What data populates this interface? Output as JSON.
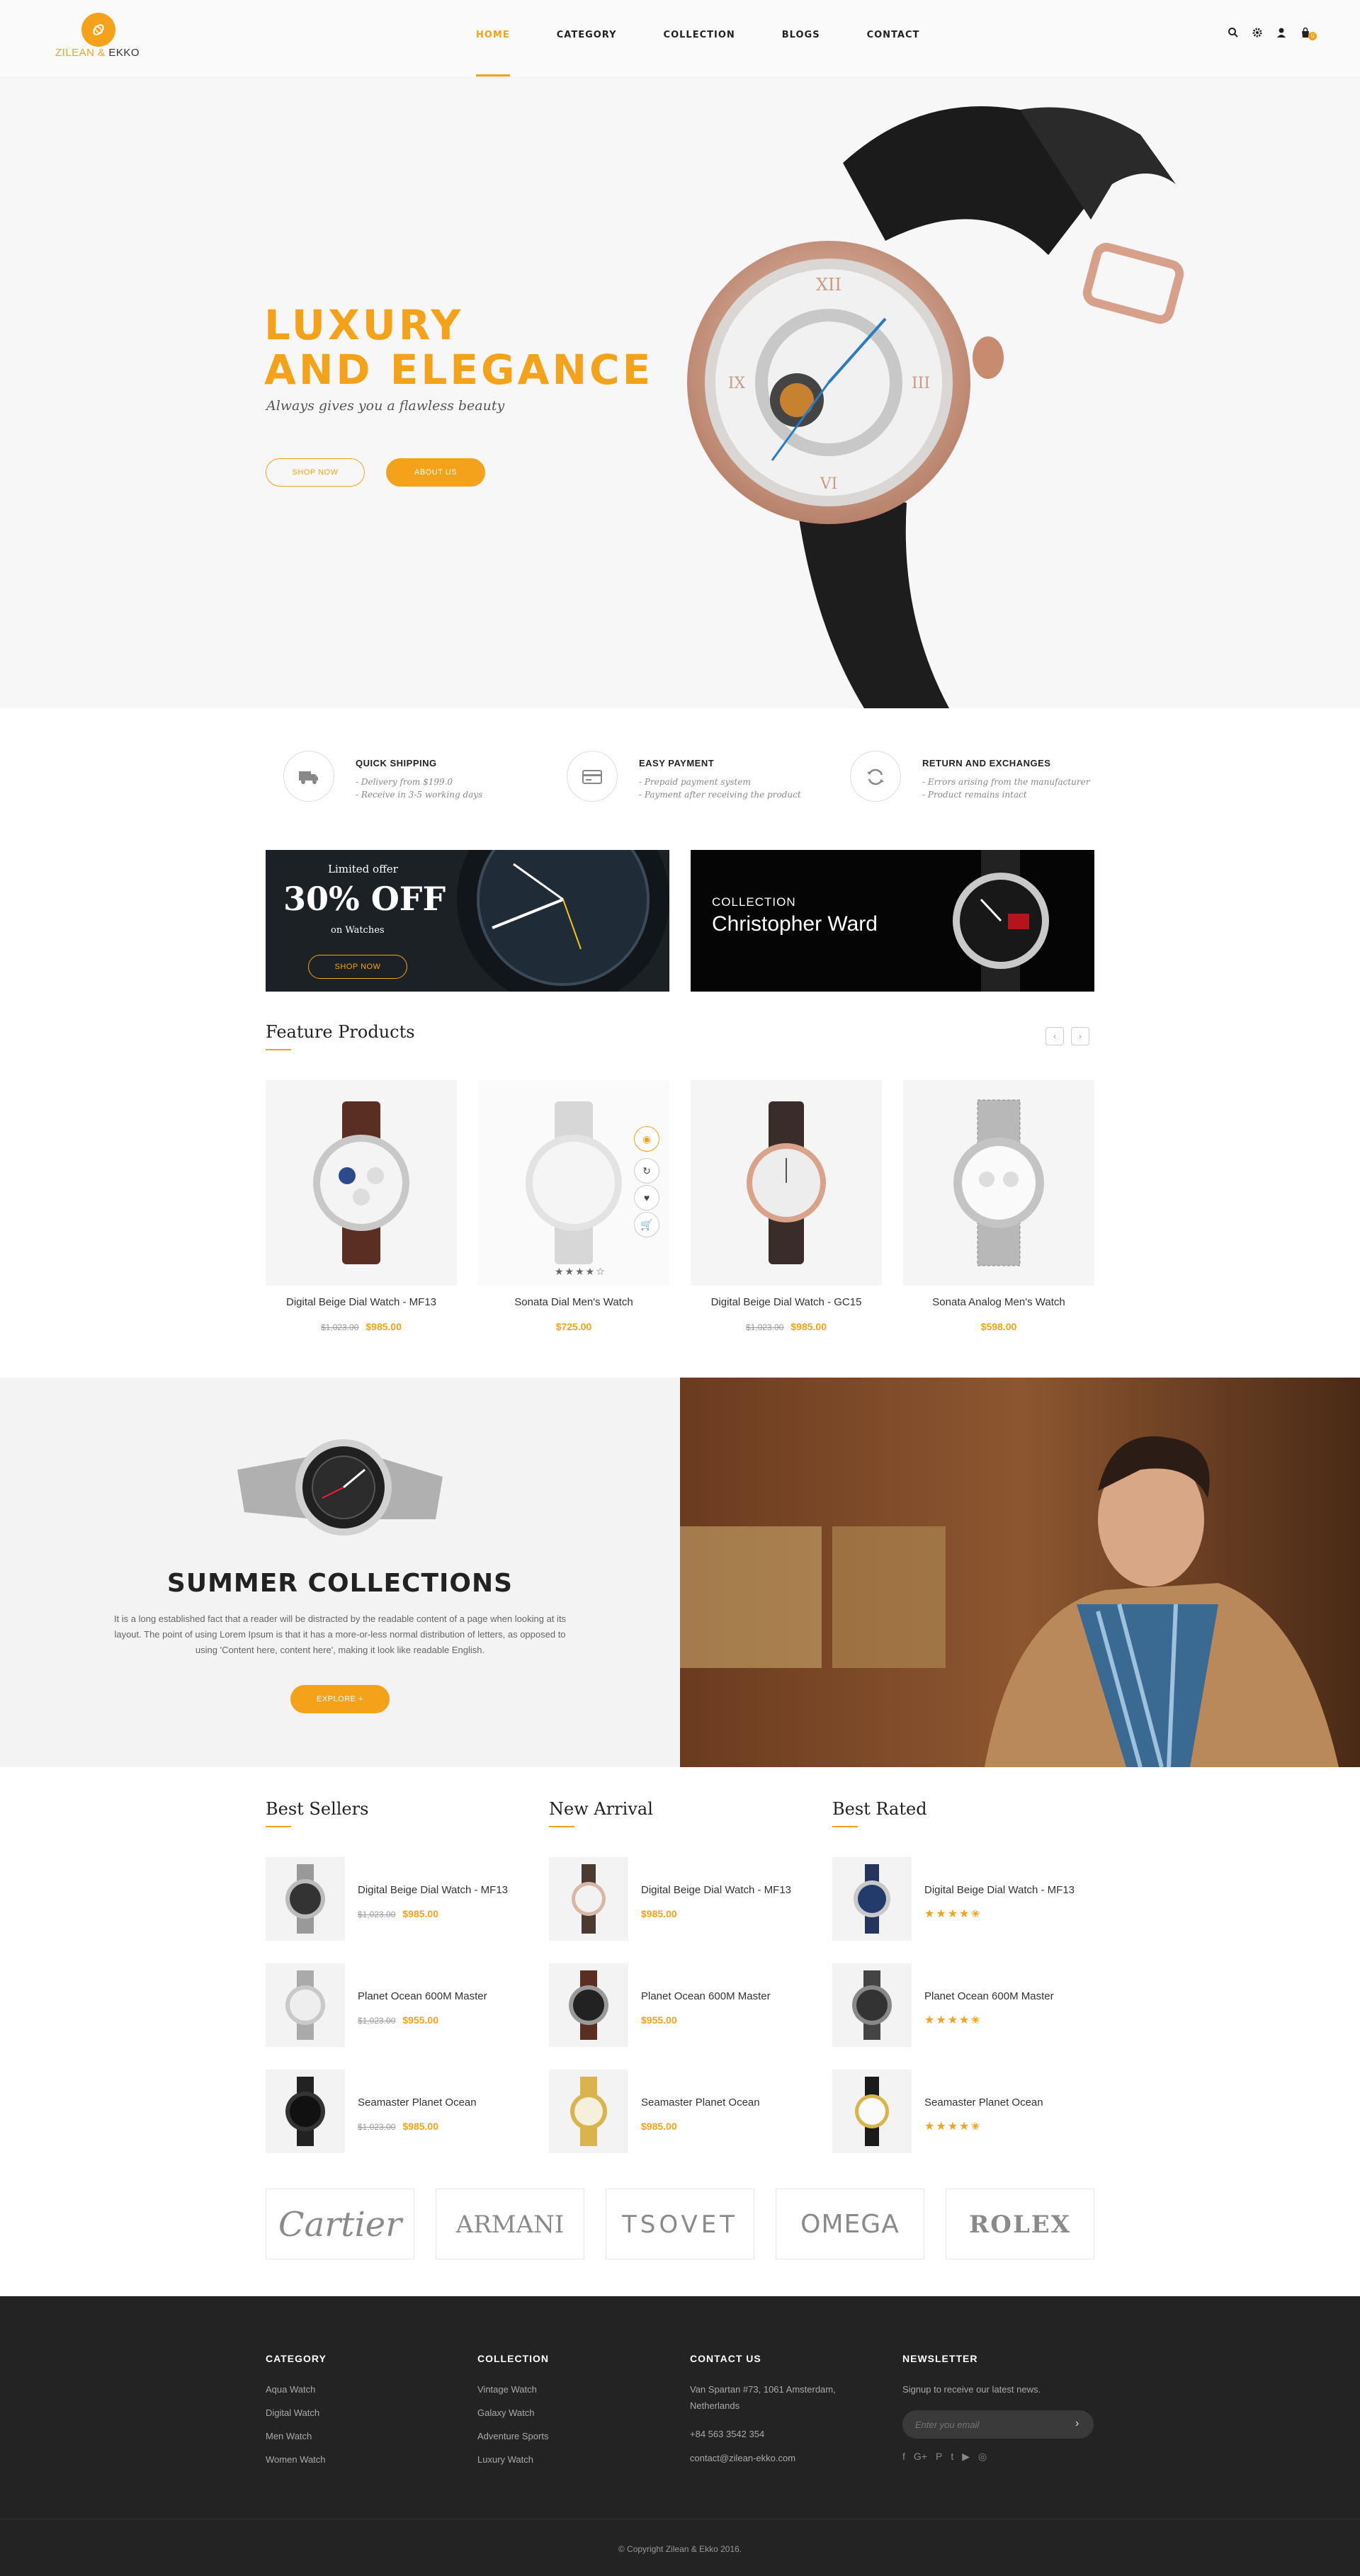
{
  "brand": {
    "name_part1": "ZILEAN & ",
    "name_part2": "EKKO",
    "accent": "#f5a21b"
  },
  "nav": {
    "items": [
      {
        "label": "HOME",
        "active": true
      },
      {
        "label": "CATEGORY"
      },
      {
        "label": "COLLECTION"
      },
      {
        "label": "BLOGS"
      },
      {
        "label": "CONTACT"
      }
    ]
  },
  "header_icons": [
    "search-icon",
    "gear-icon",
    "user-icon",
    "cart-icon"
  ],
  "cart_count": "0",
  "hero": {
    "title_line1": "LUXURY",
    "title_line2": "AND ELEGANCE",
    "subtitle": "Always gives you a flawless beauty",
    "btn_shop": "SHOP NOW",
    "btn_about": "ABOUT US"
  },
  "features": [
    {
      "icon": "truck-icon",
      "title": "QUICK SHIPPING",
      "line1": "- Delivery from $199.0",
      "line2": "- Receive in 3-5 working days"
    },
    {
      "icon": "credit-card-icon",
      "title": "EASY PAYMENT",
      "line1": "- Prepaid payment system",
      "line2": "- Payment after receiving the product"
    },
    {
      "icon": "refresh-icon",
      "title": "RETURN AND EXCHANGES",
      "line1": "- Errors arising from the manufacturer",
      "line2": "- Product remains intact"
    }
  ],
  "banner1": {
    "small": "Limited offer",
    "big": "30% OFF",
    "sub": "on Watches",
    "btn": "SHOP NOW"
  },
  "banner2": {
    "small": "COLLECTION",
    "big": "Christopher Ward"
  },
  "featured": {
    "title": "Feature Products",
    "products": [
      {
        "name": "Digital Beige Dial Watch - MF13",
        "old_price": "$1,023.00",
        "price": "$985.00"
      },
      {
        "name": "Sonata Dial Men's Watch",
        "old_price": "",
        "price": "$725.00"
      },
      {
        "name": "Digital Beige Dial Watch - GC15",
        "old_price": "$1,023.00",
        "price": "$985.00"
      },
      {
        "name": "Sonata Analog Men's Watch",
        "old_price": "",
        "price": "$598.00"
      }
    ]
  },
  "summer": {
    "title": "SUMMER COLLECTIONS",
    "text": "It is a long established fact that a reader will be distracted by the readable content of a page when looking at its layout. The point of using Lorem Ipsum is that it has a more-or-less normal distribution of letters, as opposed to using 'Content here, content here', making it look like readable English.",
    "btn": "EXPLORE +"
  },
  "best_sellers": {
    "title": "Best Sellers",
    "items": [
      {
        "name": "Digital Beige Dial Watch - MF13",
        "old_price": "$1,023.00",
        "price": "$985.00"
      },
      {
        "name": "Planet Ocean 600M Master",
        "old_price": "$1,023.00",
        "price": "$955.00"
      },
      {
        "name": "Seamaster Planet Ocean",
        "old_price": "$1,023.00",
        "price": "$985.00"
      }
    ]
  },
  "new_arrival": {
    "title": "New Arrival",
    "items": [
      {
        "name": "Digital Beige Dial Watch - MF13",
        "price": "$985.00"
      },
      {
        "name": "Planet Ocean 600M Master",
        "price": "$955.00"
      },
      {
        "name": "Seamaster Planet Ocean",
        "price": "$985.00"
      }
    ]
  },
  "best_rated": {
    "title": "Best Rated",
    "items": [
      {
        "name": "Digital Beige Dial Watch - MF13",
        "rating": 4.5
      },
      {
        "name": "Planet Ocean 600M Master",
        "rating": 4.5
      },
      {
        "name": "Seamaster Planet Ocean",
        "rating": 4.5
      }
    ]
  },
  "brands": [
    "Cartier",
    "ARMANI",
    "TSOVET",
    "OMEGA",
    "ROLEX"
  ],
  "footer": {
    "category": {
      "title": "CATEGORY",
      "links": [
        "Aqua Watch",
        "Digital Watch",
        "Men Watch",
        "Women Watch"
      ]
    },
    "collection": {
      "title": "COLLECTION",
      "links": [
        "Vintage Watch",
        "Galaxy Watch",
        "Adventure Sports",
        "Luxury Watch"
      ]
    },
    "contact": {
      "title": "CONTACT US",
      "address1": "Van Spartan #73, 1061 Amsterdam,",
      "address2": "Netherlands",
      "phone": "+84 563 3542 354",
      "email": "contact@zilean-ekko.com"
    },
    "newsletter": {
      "title": "NEWSLETTER",
      "text": "Signup to receive our latest news.",
      "placeholder": "Enter you email"
    },
    "social": [
      "facebook-icon",
      "google-plus-icon",
      "pinterest-icon",
      "twitter-icon",
      "youtube-icon",
      "instagram-icon"
    ],
    "copyright": "© Copyright  Zilean & Ekko 2016."
  }
}
